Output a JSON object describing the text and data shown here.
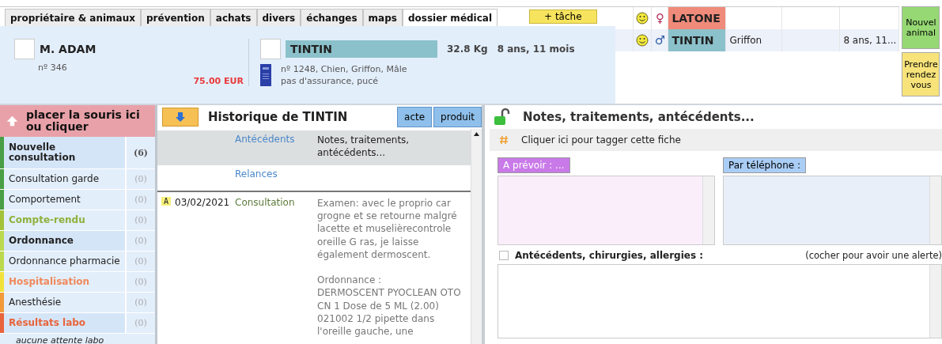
{
  "tabs": [
    {
      "label": "propriétaire & animaux",
      "selected": false
    },
    {
      "label": "prévention",
      "selected": false
    },
    {
      "label": "achats",
      "selected": false
    },
    {
      "label": "divers",
      "selected": false
    },
    {
      "label": "échanges",
      "selected": false
    },
    {
      "label": "maps",
      "selected": false
    },
    {
      "label": "dossier médical",
      "selected": true
    }
  ],
  "task_button": "+ tâche",
  "owner": {
    "name": "M. ADAM",
    "number": "nº 346",
    "balance": "75.00 EUR"
  },
  "animal": {
    "name": "TINTIN",
    "weight": "32.8 Kg",
    "age": "8 ans, 11 mois",
    "details": "nº 1248, Chien, Griffon, Mâle",
    "insurance": "pas d'assurance, pucé"
  },
  "animals": [
    {
      "name": "LATONE",
      "sex": "♀",
      "color": "#f08a7a",
      "selected": false
    },
    {
      "name": "TINTIN",
      "sex": "♂",
      "breed": "Griffon",
      "age": "8 ans, 11...",
      "color": "#8bc1cb",
      "selected": true
    }
  ],
  "side_buttons": [
    {
      "label": "Nouvel animal",
      "kind": "green"
    },
    {
      "label": "Prendre rendez vous",
      "kind": "yellow"
    }
  ],
  "sidebar": {
    "header": "placer la souris ici ou cliquer",
    "items": [
      {
        "label": "Nouvelle consultation",
        "count": "(6)",
        "color": "#4a9e45",
        "kind": "bold",
        "highlighted": true
      },
      {
        "label": "Consultation garde",
        "count": "(0)",
        "color": "#4a9e45",
        "kind": "plain",
        "highlighted": false
      },
      {
        "label": "Comportement",
        "count": "(0)",
        "color": "#4a9e45",
        "kind": "plain",
        "highlighted": false
      },
      {
        "label": "Compte-rendu",
        "count": "(0)",
        "color": "#a3c23a",
        "kind": "green",
        "highlighted": false
      },
      {
        "label": "Ordonnance",
        "count": "(0)",
        "color": "#bcd94e",
        "kind": "bold",
        "highlighted": true
      },
      {
        "label": "Ordonnance pharmacie",
        "count": "(0)",
        "color": "#bcd94e",
        "kind": "plain",
        "highlighted": false
      },
      {
        "label": "Hospitalisation",
        "count": "(0)",
        "color": "#f2e13a",
        "kind": "orange",
        "highlighted": false
      },
      {
        "label": "Anesthésie",
        "count": "(0)",
        "color": "#f29a3a",
        "kind": "plain",
        "highlighted": false
      },
      {
        "label": "Résultats labo",
        "count": "(0)",
        "color": "#e8643a",
        "kind": "red",
        "highlighted": true
      }
    ],
    "footer": "aucune attente labo"
  },
  "history": {
    "title": "Historique de TINTIN",
    "buttons": [
      "acte",
      "produit"
    ],
    "entries": [
      {
        "type": "Antécédents",
        "text": "Notes, traitements, antécédents...",
        "kind": "pinned"
      },
      {
        "type": "Relances",
        "kind": "plain"
      },
      {
        "badge": "A",
        "date": "03/02/2021",
        "type": "Consultation",
        "text": "Examen: avec le proprio car grogne et se retourne malgré lacette et muselièrecontrole oreille G ras, je laisse également dermoscent.\n\nOrdonnance :\nDERMOSCENT PYOCLEAN OTO CN 1 Dose de 5 ML (2.00) 021002 1/2 pipette dans l'oreille gauche, une",
        "kind": "record"
      }
    ]
  },
  "notes": {
    "title": "Notes, traitements, antécédents...",
    "tag_hint": "Cliquer ici pour tagger cette fiche",
    "plan_label": "A prévoir : ...",
    "phone_label": "Par téléphone :",
    "history_label": "Antécédents, chirurgies, allergies :",
    "history_alert": false,
    "history_hint": "(cocher pour avoir une alerte)"
  }
}
